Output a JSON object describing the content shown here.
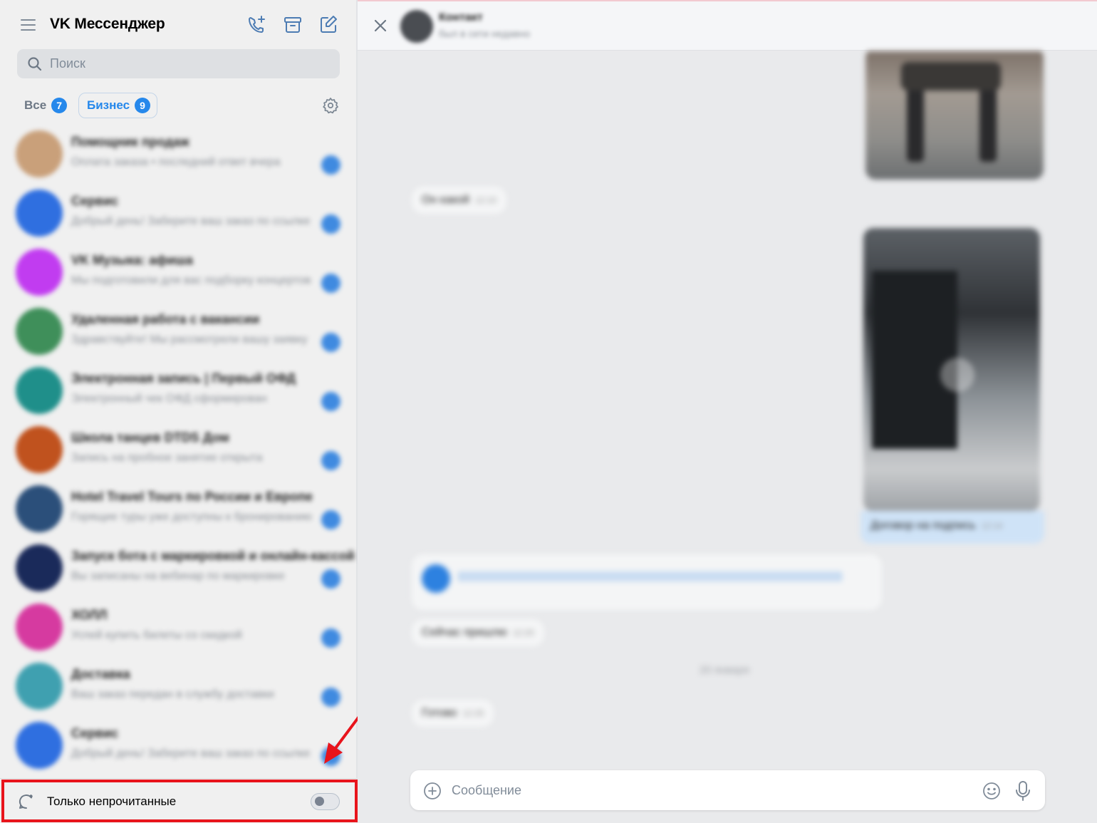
{
  "sidebar": {
    "app_title": "VK Мессенджер",
    "icons": {
      "menu": "hamburger-icon",
      "call": "phone-add-icon",
      "archive": "archive-icon",
      "compose": "compose-icon"
    },
    "search": {
      "placeholder": "Поиск"
    },
    "filters": [
      {
        "label": "Все",
        "count": "7",
        "active": false
      },
      {
        "label": "Бизнес",
        "count": "9",
        "active": true
      }
    ],
    "chats": [
      {
        "name": "Помощник продаж",
        "preview": "Оплата заказа • последний ответ вчера",
        "avatar_color": "#c9a07a"
      },
      {
        "name": "Сервис",
        "preview": "Добрый день! Заберите ваш заказ по ссылке",
        "avatar_color": "#2f6fe0"
      },
      {
        "name": "VK Музыка: афиша",
        "preview": "Мы подготовили для вас подборку концертов",
        "avatar_color": "#c13cf0"
      },
      {
        "name": "Удаленная работа с вакансии",
        "preview": "Здравствуйте! Мы рассмотрели вашу заявку",
        "avatar_color": "#3f8f5a"
      },
      {
        "name": "Электронная запись | Первый ОФД",
        "preview": "Электронный чек ОФД сформирован",
        "avatar_color": "#1f8f8a"
      },
      {
        "name": "Школа танцев DTDS Дом",
        "preview": "Запись на пробное занятие открыта",
        "avatar_color": "#c0521e"
      },
      {
        "name": "Hotel Travel Tours по России и Европе",
        "preview": "Горящие туры уже доступны к бронированию",
        "avatar_color": "#2b4f7a"
      },
      {
        "name": "Запуск бота с маркировкой и онлайн-кассой",
        "preview": "Вы записаны на вебинар по маркировке",
        "avatar_color": "#1a2a5a"
      },
      {
        "name": "ХОЛЛ",
        "preview": "Успей купить билеты со скидкой",
        "avatar_color": "#d63aa0"
      },
      {
        "name": "Доставка",
        "preview": "Ваш заказ передан в службу доставки",
        "avatar_color": "#3fa0b0"
      },
      {
        "name": "Сервис",
        "preview": "Добрый день! Заберите ваш заказ по ссылке",
        "avatar_color": "#2f6fe0"
      }
    ],
    "unread_only": {
      "label": "Только непрочитанные",
      "enabled": false
    }
  },
  "conversation": {
    "peer_name": "Контакт",
    "peer_status": "был в сети недавно",
    "messages": [
      {
        "text": "Он какой",
        "time": "12:10",
        "side": "in"
      },
      {
        "text": "Договор на подпись",
        "time": "12:14",
        "side": "out"
      },
      {
        "text": "Сейчас пришлю",
        "time": "12:20",
        "side": "in"
      },
      {
        "text": "Готово",
        "time": "12:25",
        "side": "in"
      }
    ],
    "date_separator": "20 января",
    "composer": {
      "placeholder": "Сообщение"
    }
  },
  "colors": {
    "accent": "#2688eb",
    "highlight": "#e8141c"
  }
}
